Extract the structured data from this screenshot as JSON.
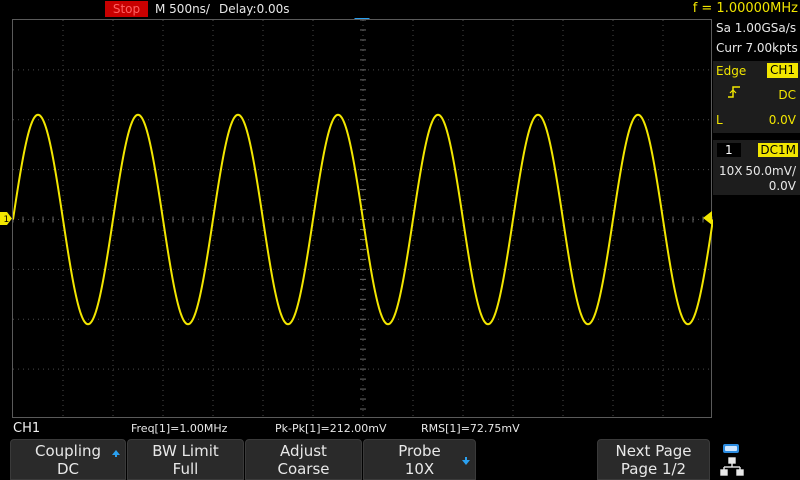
{
  "topbar": {
    "run_state": "Stop",
    "timebase": "M 500ns/",
    "delay": "Delay:0.00s",
    "frequency_counter": "f = 1.00000MHz"
  },
  "acquisition": {
    "sample_rate": "Sa 1.00GSa/s",
    "memory_depth": "Curr 7.00kpts"
  },
  "trigger": {
    "type": "Edge",
    "source": "CH1",
    "slope_icon": "rising-edge-icon",
    "coupling": "DC",
    "level_label": "L",
    "level_value": "0.0V"
  },
  "channel": {
    "number": "1",
    "coupling_impedance": "DC1M",
    "probe": "10X",
    "scale": "50.0mV/",
    "offset": "0.0V",
    "marker": "1",
    "color": "#f2e600"
  },
  "measurements": {
    "channel_label": "CH1",
    "items": [
      "Freq[1]=1.00MHz",
      "Pk-Pk[1]=212.00mV",
      "RMS[1]=72.75mV"
    ]
  },
  "softkeys": [
    {
      "line1": "Coupling",
      "line2": "DC",
      "arrow": "up"
    },
    {
      "line1": "BW Limit",
      "line2": "Full",
      "arrow": ""
    },
    {
      "line1": "Adjust",
      "line2": "Coarse",
      "arrow": ""
    },
    {
      "line1": "Probe",
      "line2": "10X",
      "arrow": "down"
    },
    {
      "line1": "Next Page",
      "line2": "Page 1/2",
      "arrow": ""
    }
  ],
  "waveform": {
    "frequency_hz": 1000000,
    "amplitude_divisions": 2.1,
    "cycles_on_screen": 7,
    "color": "#f2e600"
  }
}
